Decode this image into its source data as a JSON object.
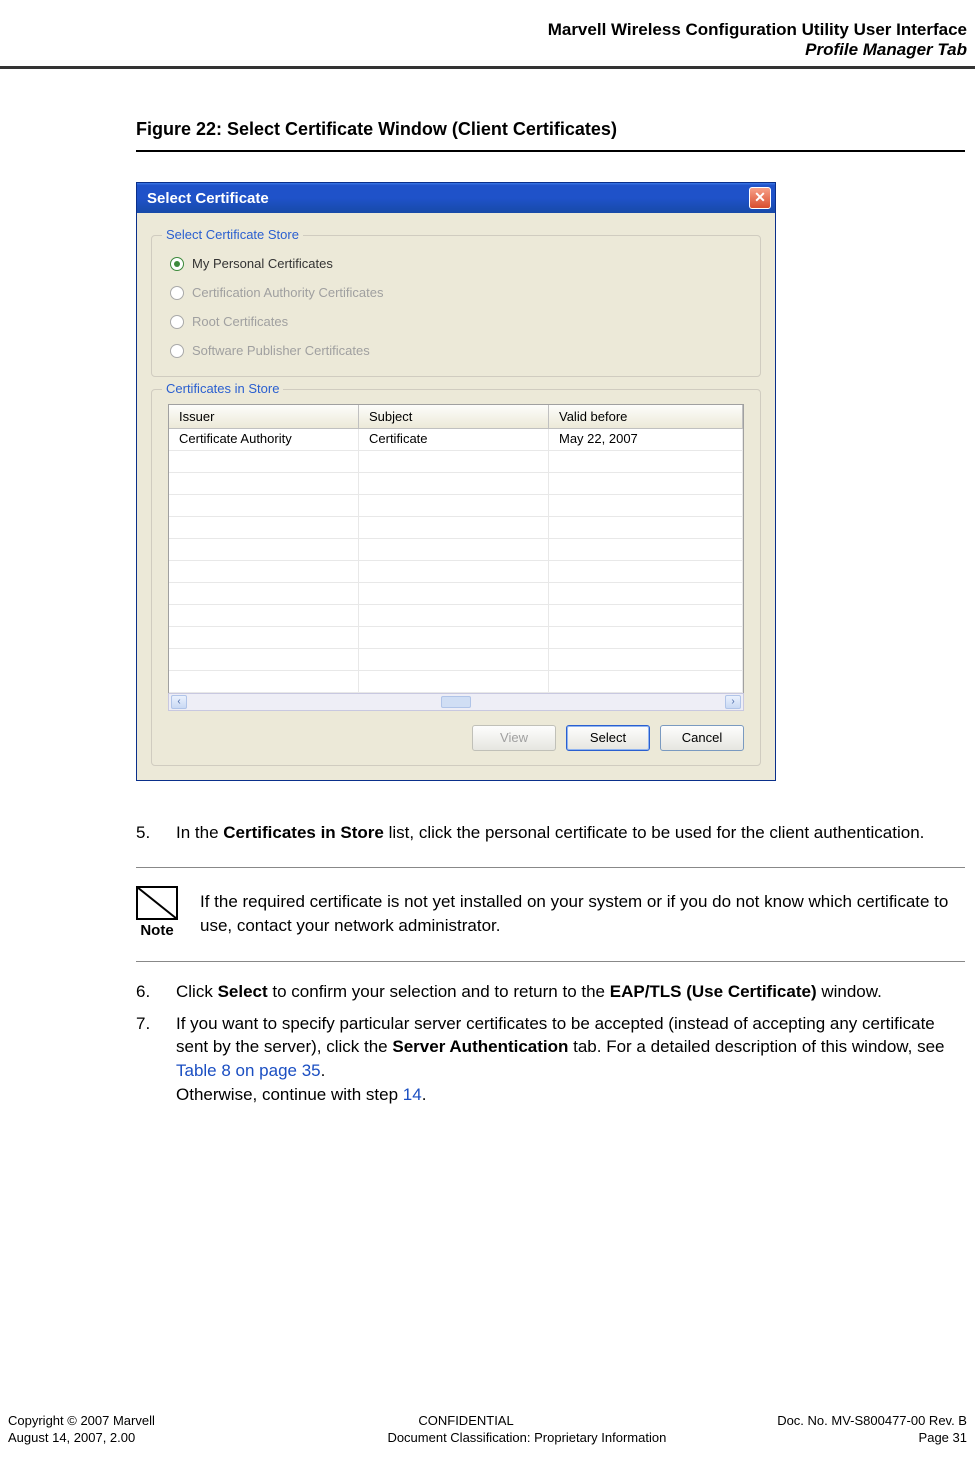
{
  "header": {
    "line1": "Marvell Wireless Configuration Utility User Interface",
    "line2": "Profile Manager Tab"
  },
  "figure_caption": "Figure 22: Select Certificate Window (Client Certificates)",
  "dialog": {
    "title": "Select Certificate",
    "group_store": {
      "title": "Select Certificate Store",
      "options": [
        "My Personal Certificates",
        "Certification Authority Certificates",
        "Root Certificates",
        "Software Publisher Certificates"
      ],
      "selected_index": 0
    },
    "group_list": {
      "title": "Certificates in Store",
      "columns": [
        "Issuer",
        "Subject",
        "Valid before"
      ],
      "rows": [
        {
          "issuer": "Certificate Authority",
          "subject": "Certificate",
          "valid_before": "May 22, 2007"
        }
      ]
    },
    "buttons": {
      "view": "View",
      "select": "Select",
      "cancel": "Cancel"
    }
  },
  "steps": {
    "s5_num": "5.",
    "s5_a": "In the ",
    "s5_b": "Certificates in Store",
    "s5_c": " list, click the personal certificate to be used for the client authentication.",
    "s6_num": "6.",
    "s6_a": "Click ",
    "s6_b": "Select",
    "s6_c": " to confirm your selection and to return to the ",
    "s6_d": "EAP/TLS (Use Certificate)",
    "s6_e": " window.",
    "s7_num": "7.",
    "s7_a": "If you want to specify particular server certificates to be accepted (instead of accepting any certificate sent by the server), click the ",
    "s7_b": "Server Authentication",
    "s7_c": " tab. For a detailed description of this window, see ",
    "s7_link": "Table 8 on page 35",
    "s7_d": ".",
    "s7_e": "Otherwise, continue with step ",
    "s7_link2": "14",
    "s7_f": "."
  },
  "note": {
    "label": "Note",
    "text": "If the required certificate is not yet installed on your system or if you do not know which certificate to use, contact your network administrator."
  },
  "footer": {
    "left1": "Copyright © 2007 Marvell",
    "center1": "CONFIDENTIAL",
    "right1": "Doc. No. MV-S800477-00 Rev. B",
    "left2": "August 14, 2007, 2.00",
    "center2": "Document Classification: Proprietary Information",
    "right2": "Page 31"
  }
}
